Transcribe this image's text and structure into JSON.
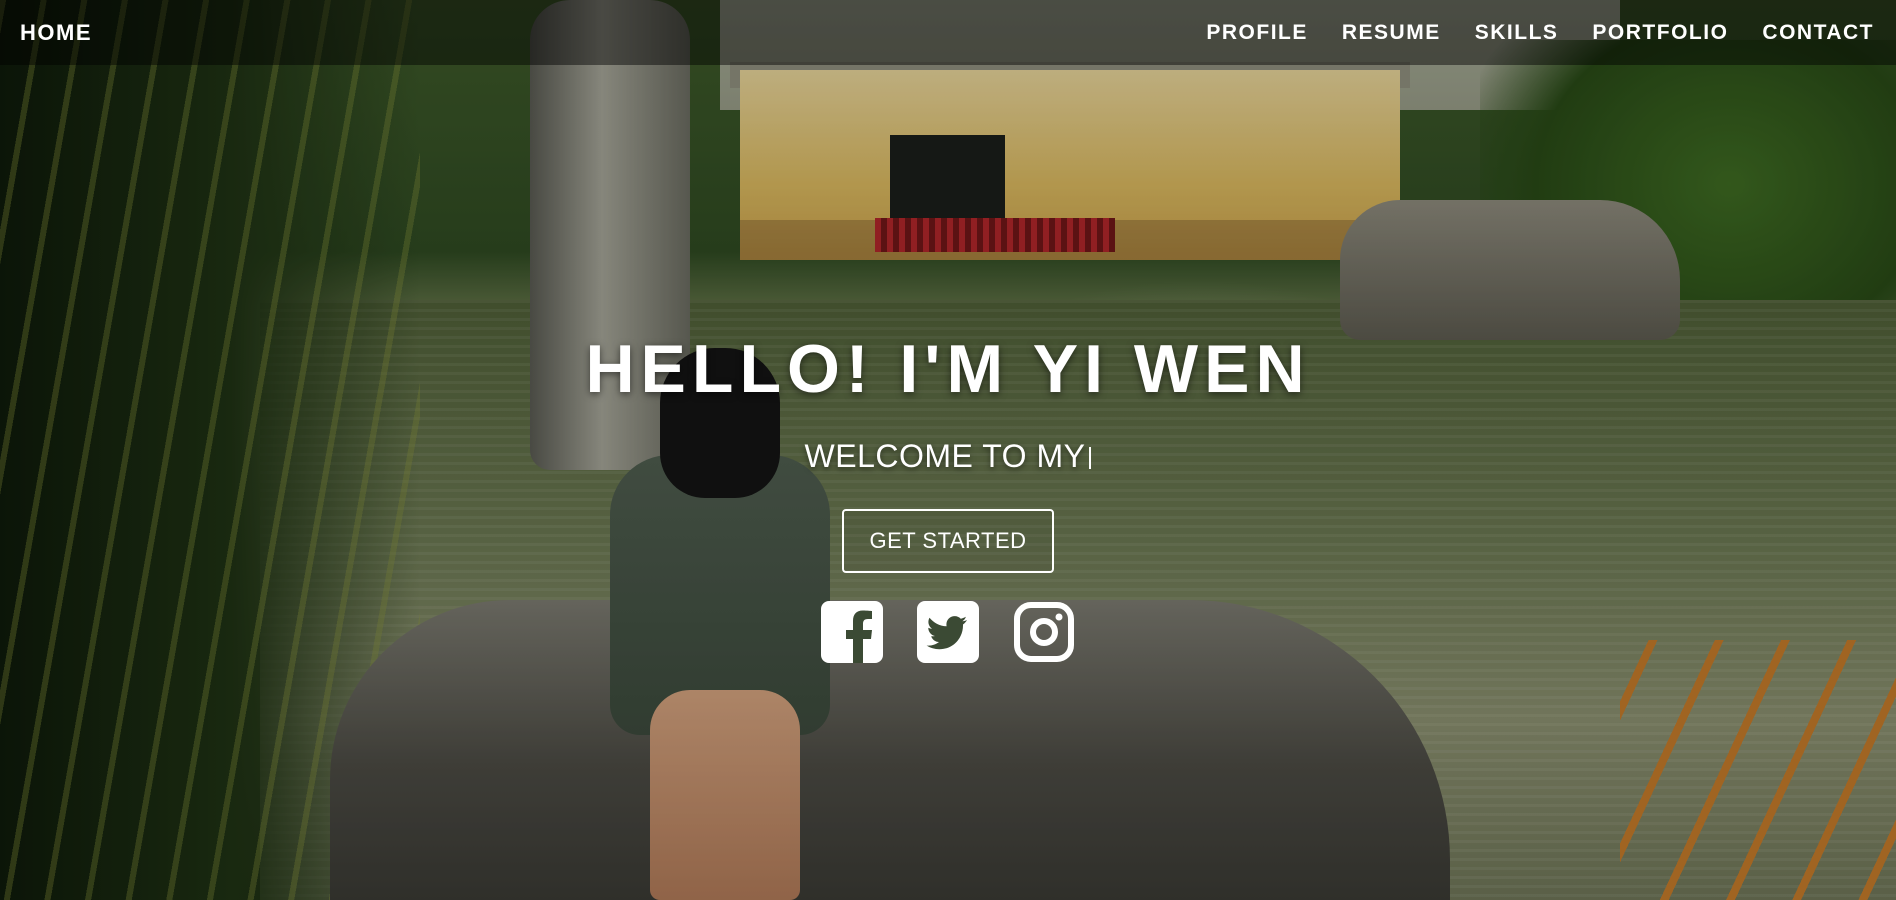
{
  "navbar": {
    "brand": "HOME",
    "links": [
      "PROFILE",
      "RESUME",
      "SKILLS",
      "PORTFOLIO",
      "CONTACT"
    ]
  },
  "hero": {
    "title": "HELLO! I'M YI WEN",
    "subtitle": "WELCOME TO MY",
    "cta_label": "GET STARTED"
  },
  "socials": [
    {
      "icon": "facebook-icon"
    },
    {
      "icon": "twitter-icon"
    },
    {
      "icon": "instagram-icon"
    }
  ],
  "colors": {
    "text": "#ffffff",
    "navbar_bg": "rgba(0,0,0,0.45)"
  }
}
